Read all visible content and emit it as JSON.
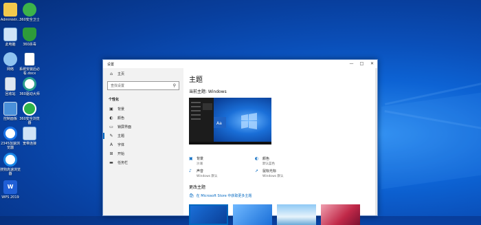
{
  "desktop": {
    "icons": [
      {
        "label": "Administr..."
      },
      {
        "label": "360安全卫士"
      },
      {
        "label": "此电脑"
      },
      {
        "label": "360杀毒"
      },
      {
        "label": "网络"
      },
      {
        "label": "系统安装后必看.docx"
      },
      {
        "label": "回收站"
      },
      {
        "label": "360驱动大师"
      },
      {
        "label": "控制面板"
      },
      {
        "label": "360安全浏览器"
      },
      {
        "label": "2345加速浏览器"
      },
      {
        "label": "宽带连接"
      },
      {
        "label": "搜狗高速浏览器"
      },
      {
        "label": "WPS 2019"
      }
    ]
  },
  "window": {
    "title": "设置",
    "controls": {
      "minimize": "—",
      "maximize": "□",
      "close": "✕"
    },
    "sidebar": {
      "home_label": "主页",
      "search_placeholder": "查找设置",
      "section_title": "个性化",
      "items": [
        {
          "label": "背景"
        },
        {
          "label": "颜色"
        },
        {
          "label": "锁屏界面"
        },
        {
          "label": "主题"
        },
        {
          "label": "字体"
        },
        {
          "label": "开始"
        },
        {
          "label": "任务栏"
        }
      ]
    },
    "main": {
      "page_title": "主题",
      "current_theme": "当前主题: Windows",
      "settings": [
        {
          "name": "背景",
          "value": "沙滩"
        },
        {
          "name": "颜色",
          "value": "默认蓝色"
        },
        {
          "name": "声音",
          "value": "Windows 默认"
        },
        {
          "name": "鼠标光标",
          "value": "Windows 默认"
        }
      ],
      "change_theme": "更改主题",
      "store_link": "在 Microsoft Store 中获取更多主题"
    }
  }
}
